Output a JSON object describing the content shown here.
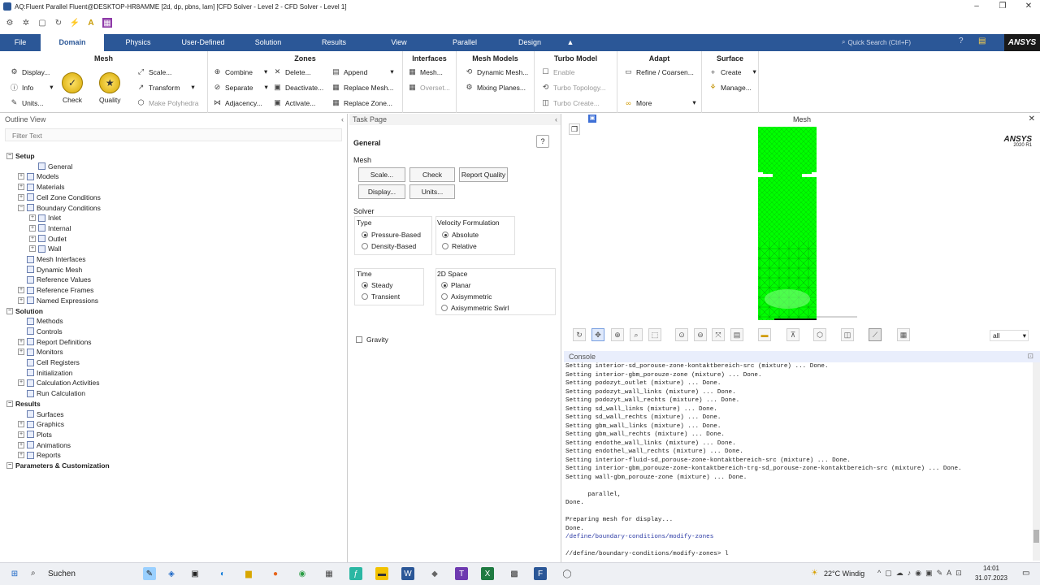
{
  "window": {
    "title": "AQ:Fluent Parallel Fluent@DESKTOP-HR8AMME  [2d, dp, pbns, lam] [CFD Solver - Level 2 - CFD Solver - Level 1]"
  },
  "ribbon_tabs": [
    "File",
    "Domain",
    "Physics",
    "User-Defined",
    "Solution",
    "Results",
    "View",
    "Parallel",
    "Design"
  ],
  "search_placeholder": "Quick Search (Ctrl+F)",
  "brand": "ANSYS",
  "ribbon": {
    "mesh": {
      "title": "Mesh",
      "display": "Display...",
      "info": "Info",
      "units": "Units...",
      "check": "Check",
      "quality": "Quality"
    },
    "mesh2": {
      "scale": "Scale...",
      "transform": "Transform",
      "polyhedra": "Make Polyhedra"
    },
    "zones": {
      "title": "Zones",
      "combine": "Combine",
      "separate": "Separate",
      "adjacency": "Adjacency...",
      "delete": "Delete...",
      "deactivate": "Deactivate...",
      "activate": "Activate...",
      "append": "Append",
      "replace_mesh": "Replace Mesh...",
      "replace_zone": "Replace Zone..."
    },
    "interfaces": {
      "title": "Interfaces",
      "mesh": "Mesh...",
      "overset": "Overset..."
    },
    "mesh_models": {
      "title": "Mesh Models",
      "dynamic": "Dynamic Mesh...",
      "mixing": "Mixing Planes..."
    },
    "turbo": {
      "title": "Turbo Model",
      "enable": "Enable",
      "topology": "Turbo Topology...",
      "create": "Turbo Create..."
    },
    "adapt": {
      "title": "Adapt",
      "refine": "Refine / Coarsen...",
      "more": "More"
    },
    "surface": {
      "title": "Surface",
      "create": "Create",
      "manage": "Manage..."
    }
  },
  "outline": {
    "title": "Outline View",
    "filter": "Filter Text",
    "rows": [
      {
        "label": "Setup",
        "level": 0,
        "bold": true
      },
      {
        "label": "General",
        "level": 2
      },
      {
        "label": "Models",
        "level": 1
      },
      {
        "label": "Materials",
        "level": 1
      },
      {
        "label": "Cell Zone Conditions",
        "level": 1
      },
      {
        "label": "Boundary Conditions",
        "level": 1
      },
      {
        "label": "Inlet",
        "level": 2
      },
      {
        "label": "Internal",
        "level": 2
      },
      {
        "label": "Outlet",
        "level": 2
      },
      {
        "label": "Wall",
        "level": 2
      },
      {
        "label": "Mesh Interfaces",
        "level": 1
      },
      {
        "label": "Dynamic Mesh",
        "level": 1
      },
      {
        "label": "Reference Values",
        "level": 1
      },
      {
        "label": "Reference Frames",
        "level": 1
      },
      {
        "label": "Named Expressions",
        "level": 1
      },
      {
        "label": "Solution",
        "level": 0,
        "bold": true
      },
      {
        "label": "Methods",
        "level": 1
      },
      {
        "label": "Controls",
        "level": 1
      },
      {
        "label": "Report Definitions",
        "level": 1
      },
      {
        "label": "Monitors",
        "level": 1
      },
      {
        "label": "Cell Registers",
        "level": 1
      },
      {
        "label": "Initialization",
        "level": 1
      },
      {
        "label": "Calculation Activities",
        "level": 1
      },
      {
        "label": "Run Calculation",
        "level": 1
      },
      {
        "label": "Results",
        "level": 0,
        "bold": true
      },
      {
        "label": "Surfaces",
        "level": 1
      },
      {
        "label": "Graphics",
        "level": 1
      },
      {
        "label": "Plots",
        "level": 1
      },
      {
        "label": "Animations",
        "level": 1
      },
      {
        "label": "Reports",
        "level": 1
      },
      {
        "label": "Parameters & Customization",
        "level": 0,
        "bold": true
      }
    ]
  },
  "task": {
    "title": "Task Page",
    "general": "General",
    "mesh": "Mesh",
    "btn_scale": "Scale...",
    "btn_check": "Check",
    "btn_quality": "Report Quality",
    "btn_display": "Display...",
    "btn_units": "Units...",
    "solver": "Solver",
    "type": "Type",
    "pressure": "Pressure-Based",
    "density": "Density-Based",
    "velocity": "Velocity Formulation",
    "absolute": "Absolute",
    "relative": "Relative",
    "time": "Time",
    "steady": "Steady",
    "transient": "Transient",
    "space": "2D Space",
    "planar": "Planar",
    "axisym": "Axisymmetric",
    "axiswirl": "Axisymmetric Swirl",
    "gravity": "Gravity"
  },
  "graphics": {
    "title": "Mesh",
    "brand": "ANSYS",
    "version": "2020 R1",
    "view_select": "all"
  },
  "console": {
    "title": "Console",
    "lines": [
      "Setting interior-sd_porouse-zone-kontaktbereich-src (mixture) ... Done.",
      "Setting interior-gbm_porouze-zone (mixture) ... Done.",
      "Setting podozyt_outlet (mixture) ... Done.",
      "Setting podozyt_wall_links (mixture) ... Done.",
      "Setting podozyt_wall_rechts (mixture) ... Done.",
      "Setting sd_wall_links (mixture) ... Done.",
      "Setting sd_wall_rechts (mixture) ... Done.",
      "Setting gbm_wall_links (mixture) ... Done.",
      "Setting gbm_wall_rechts (mixture) ... Done.",
      "Setting endothe_wall_links (mixture) ... Done.",
      "Setting endothel_wall_rechts (mixture) ... Done.",
      "Setting interior-fluid-sd_porouse-zone-kontaktbereich-src (mixture) ... Done.",
      "Setting interior-gbm_porouze-zone-kontaktbereich-trg-sd_porouse-zone-kontaktbereich-src (mixture) ... Done.",
      "Setting wall-gbm_porouze-zone (mixture) ... Done.",
      "",
      "      parallel,",
      "Done.",
      "",
      "Preparing mesh for display...",
      "Done.",
      "/define/boundary-conditions/modify-zones",
      "",
      "//define/boundary-conditions/modify-zones> l"
    ]
  },
  "taskbar": {
    "search": "Suchen",
    "weather": "22°C  Windig",
    "time": "14:01",
    "date": "31.07.2023"
  },
  "colors": {
    "ribbon_blue": "#2b5797",
    "mesh_green": "#00ff00"
  }
}
